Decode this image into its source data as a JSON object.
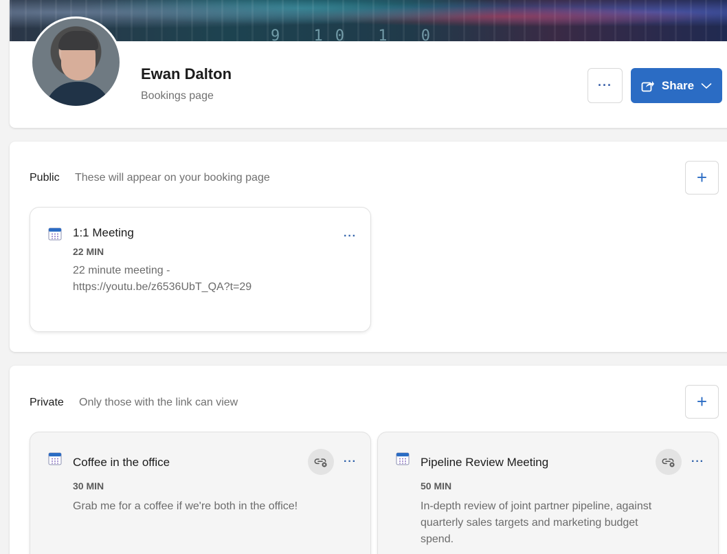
{
  "profile": {
    "name": "Ewan Dalton",
    "subtitle": "Bookings page",
    "more_label": "···",
    "share_label": "Share",
    "banner_digits": "9 10 1 0"
  },
  "public_section": {
    "title": "Public",
    "description": "These will appear on your booking page",
    "add_label": "+",
    "cards": [
      {
        "title": "1:1 Meeting",
        "duration": "22 MIN",
        "description_line1": "22 minute meeting -",
        "description_line2": "https://youtu.be/z6536UbT_QA?t=29",
        "menu_label": "···"
      }
    ]
  },
  "private_section": {
    "title": "Private",
    "description": "Only those with the link can view",
    "add_label": "+",
    "cards": [
      {
        "title": "Coffee in the office",
        "duration": "30 MIN",
        "description_line1": "Grab me for a coffee if we're both in the office!",
        "menu_label": "···"
      },
      {
        "title": "Pipeline Review Meeting",
        "duration": "50 MIN",
        "description_line1": "In-depth review of joint partner pipeline, against",
        "description_line2": "quarterly sales targets and marketing budget",
        "description_line3": "spend.",
        "menu_label": "···"
      }
    ]
  },
  "colors": {
    "accent": "#2b6cc4",
    "text_primary": "#1b1b1b",
    "text_secondary": "#707070"
  },
  "icons": {
    "share": "share-icon",
    "chevron": "chevron-down-icon",
    "calendar": "calendar-icon",
    "link": "link-icon",
    "more": "more-icon",
    "add": "add-icon"
  }
}
